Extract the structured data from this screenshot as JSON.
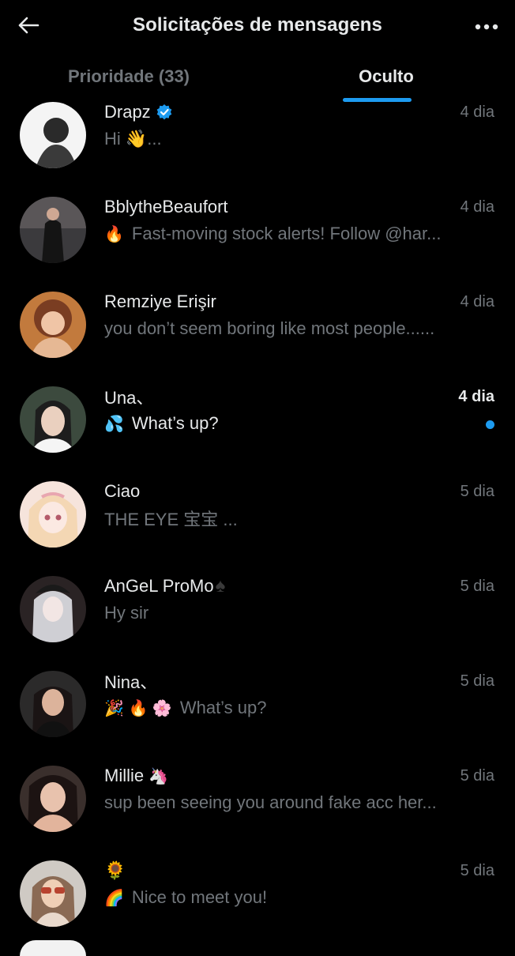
{
  "header": {
    "title": "Solicitações de mensagens",
    "back_icon": "arrow-left-icon",
    "more_icon": "more-horizontal-icon"
  },
  "tabs": [
    {
      "label": "Prioridade (33)",
      "active": false
    },
    {
      "label": "Oculto",
      "active": true
    }
  ],
  "colors": {
    "background": "#000000",
    "accent": "#1d9bf0",
    "text_primary": "#e7e9ea",
    "text_secondary": "#71767b"
  },
  "conversations": [
    {
      "name": "Drapz",
      "verified": true,
      "name_emoji": "",
      "time": "4 dia",
      "preview_emoji": "",
      "preview": "Hi 👋...",
      "unread": false,
      "avatar_icon": "avatar-photo"
    },
    {
      "name": "BblytheBeaufort",
      "verified": false,
      "name_emoji": "",
      "time": "4 dia",
      "preview_emoji": "🔥",
      "preview": "Fast-moving stock alerts! Follow @har...",
      "unread": false,
      "avatar_icon": "avatar-photo"
    },
    {
      "name": "Remziye Erişir",
      "verified": false,
      "name_emoji": "",
      "time": "4 dia",
      "preview_emoji": "",
      "preview": "you don’t seem boring like most people......",
      "unread": false,
      "avatar_icon": "avatar-photo"
    },
    {
      "name": "Una、",
      "verified": false,
      "name_emoji": "",
      "time": "4 dia",
      "preview_emoji": "💦",
      "preview": "What’s up?",
      "unread": true,
      "avatar_icon": "avatar-photo"
    },
    {
      "name": "Ciao",
      "verified": false,
      "name_emoji": "",
      "time": "5 dia",
      "preview_emoji": "",
      "preview": "THE EYE 宝宝  ...",
      "unread": false,
      "avatar_icon": "avatar-illustration"
    },
    {
      "name": "AnGeL ProMo",
      "verified": false,
      "name_emoji": "♠",
      "time": "5 dia",
      "preview_emoji": "",
      "preview": "Hy sir",
      "unread": false,
      "avatar_icon": "avatar-photo"
    },
    {
      "name": "Nina、",
      "verified": false,
      "name_emoji": "",
      "time": "5 dia",
      "preview_emoji": "🎉 🔥 🌸",
      "preview": "What’s up?",
      "unread": false,
      "avatar_icon": "avatar-photo"
    },
    {
      "name": "Millie",
      "verified": false,
      "name_emoji": "🦄",
      "time": "5 dia",
      "preview_emoji": "",
      "preview": "sup been seeing you around fake acc her...",
      "unread": false,
      "avatar_icon": "avatar-photo"
    },
    {
      "name": "",
      "verified": false,
      "name_emoji": "🌻",
      "time": "5 dia",
      "preview_emoji": "🌈",
      "preview": "Nice to meet you!",
      "unread": false,
      "avatar_icon": "avatar-photo"
    }
  ]
}
